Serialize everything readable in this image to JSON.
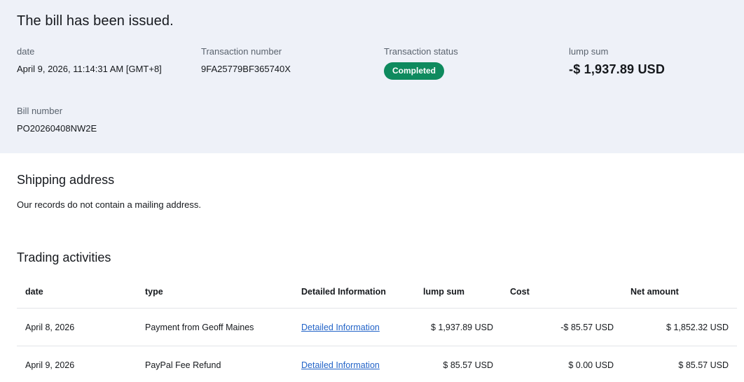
{
  "hero": {
    "title": "The bill has been issued.",
    "fields": [
      {
        "label": "date",
        "value": "April 9, 2026, 11:14:31 AM [GMT+8]"
      },
      {
        "label": "Transaction number",
        "value": "9FA25779BF365740X"
      },
      {
        "label": "Transaction status",
        "badge": "Completed"
      },
      {
        "label": "lump sum",
        "value": "-$ 1,937.89 USD"
      }
    ],
    "bill_number": {
      "label": "Bill number",
      "value": "PO20260408NW2E"
    }
  },
  "shipping": {
    "heading": "Shipping address",
    "message": "Our records do not contain a mailing address."
  },
  "trading": {
    "heading": "Trading activities",
    "columns": [
      "date",
      "type",
      "Detailed Information",
      "lump sum",
      "Cost",
      "Net amount"
    ],
    "rows": [
      {
        "date": "April 8, 2026",
        "type": "Payment from Geoff Maines",
        "link": "Detailed Information",
        "lump_sum": "$ 1,937.89 USD",
        "cost": "-$ 85.57 USD",
        "net": "$ 1,852.32 USD"
      },
      {
        "date": "April 9, 2026",
        "type": "PayPal Fee Refund",
        "link": "Detailed Information",
        "lump_sum": "$ 85.57 USD",
        "cost": "$ 0.00 USD",
        "net": "$ 85.57 USD"
      }
    ]
  },
  "colors": {
    "status_badge_green": "#0e8a5e",
    "link_blue": "#2364c8",
    "hero_background": "#eef1f8"
  }
}
